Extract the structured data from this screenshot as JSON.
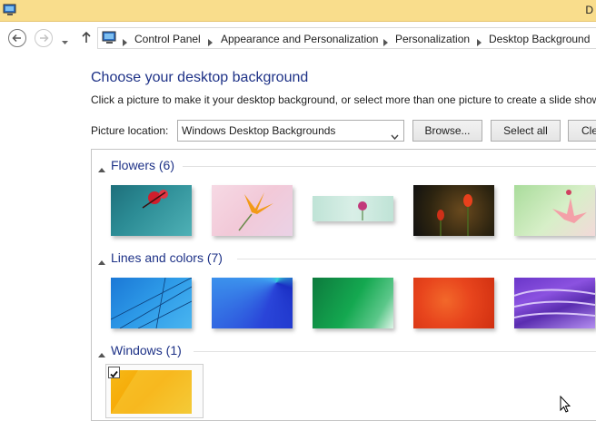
{
  "window": {
    "title_fragment": "D"
  },
  "addressbar": {
    "crumbs": [
      "Control Panel",
      "Appearance and Personalization",
      "Personalization",
      "Desktop Background"
    ]
  },
  "main": {
    "heading": "Choose your desktop background",
    "subtext": "Click a picture to make it your desktop background, or select more than one picture to create a slide show",
    "picture_location_label": "Picture location:",
    "picture_location_value": "Windows Desktop Backgrounds",
    "browse_label": "Browse...",
    "select_all_label": "Select all",
    "clear_label": "Cle"
  },
  "groups": [
    {
      "label": "Flowers (6)"
    },
    {
      "label": "Lines and colors (7)"
    },
    {
      "label": "Windows (1)"
    }
  ]
}
